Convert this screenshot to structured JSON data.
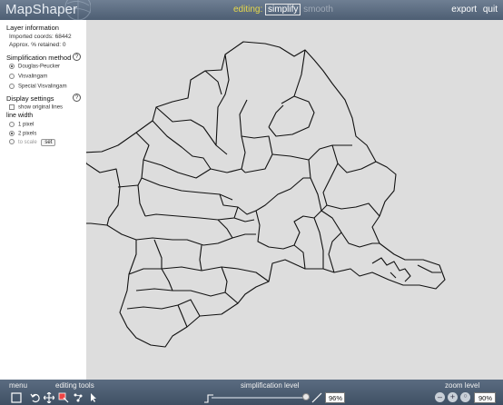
{
  "app": {
    "logo": "MapShaper"
  },
  "topbar": {
    "editing_label": "editing:",
    "simplify_label": "simplify",
    "smooth_label": "smooth",
    "export_label": "export",
    "quit_label": "quit"
  },
  "layer_info": {
    "title": "Layer information",
    "imported": "Imported coords: 68442",
    "retained": "Approx. % retained: 0"
  },
  "simplification": {
    "title": "Simplification method",
    "help": "?",
    "options": [
      "Douglas-Peucker",
      "Visvalingam",
      "Special Visvalingam"
    ],
    "selected": "Douglas-Peucker"
  },
  "display": {
    "title": "Display settings",
    "help": "?",
    "show_original": "show original lines",
    "line_width_label": "line width",
    "width_options": [
      "1 pixel",
      "2 pixels",
      "to scale"
    ],
    "selected_width": "2 pixels",
    "set_button": "set"
  },
  "bottombar": {
    "menu_label": "menu",
    "editing_tools_label": "editing tools",
    "simplification_level_label": "simplification level",
    "simplification_value": "96%",
    "simplification_fraction": 0.96,
    "zoom_level_label": "zoom level",
    "zoom_value": "90%",
    "zoom_minus": "–",
    "zoom_plus": "+"
  },
  "icons": [
    "globe-icon",
    "select-icon",
    "undo-icon",
    "pan-icon",
    "eraser-icon",
    "node-icon",
    "cursor-icon",
    "slider-end-icon",
    "help-icon"
  ]
}
